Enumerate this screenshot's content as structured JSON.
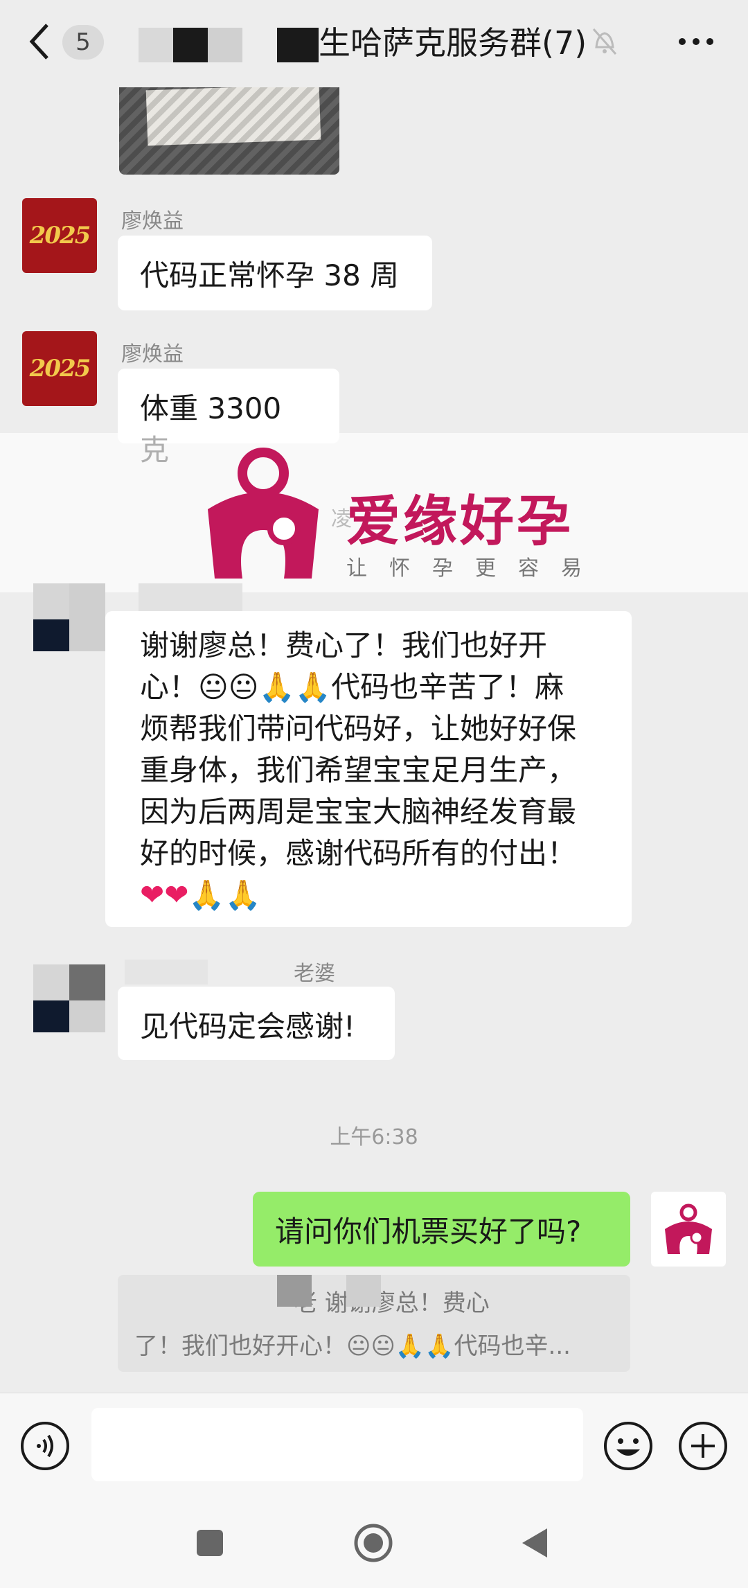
{
  "header": {
    "unread_count": "5",
    "title": "生哈萨克服务群(7)"
  },
  "messages": [
    {
      "sender": "廖焕益",
      "text": "代码正常怀孕 38 周",
      "avatar_text": "2025"
    },
    {
      "sender": "廖焕益",
      "text": "体重 3300 克",
      "avatar_text": "2025"
    },
    {
      "time_partial": "凌"
    },
    {
      "lines": [
        "谢谢廖总！费心了！我们也好开",
        "心！😐😐🙏🙏代码也辛苦了！麻",
        "烦帮我们带问代码好，让她好好保",
        "重身体，我们希望宝宝足月生产，",
        "因为后两周是宝宝大脑神经发育最",
        "好的时候，感谢代码所有的付出！",
        "❤❤🙏🙏"
      ]
    },
    {
      "sender_partial": "老婆",
      "text": "见代码定会感谢!"
    },
    {
      "time": "上午6:38"
    },
    {
      "text": "请问你们机票买好了吗?",
      "from_self": true
    },
    {
      "quote_line1": "老    谢谢廖总！费心",
      "quote_line2": "了！我们也好开心！😐😐🙏🙏代码也辛..."
    }
  ],
  "watermark": {
    "title": "爱缘好孕",
    "subtitle": "让怀孕更容易"
  },
  "colors": {
    "bubble_self": "#95ec69",
    "bubble_other": "#ffffff",
    "background": "#ededed",
    "brand": "#c2185b"
  },
  "icons": [
    "back-icon",
    "mute-bell-icon",
    "more-icon",
    "voice-icon",
    "emoji-icon",
    "plus-icon",
    "nav-recent-icon",
    "nav-home-icon",
    "nav-back-icon"
  ]
}
